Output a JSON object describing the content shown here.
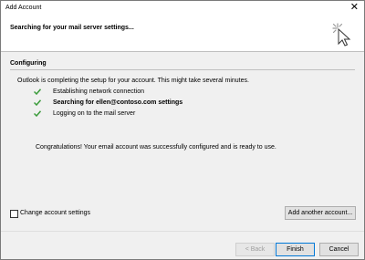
{
  "window": {
    "title": "Add Account"
  },
  "header": {
    "heading": "Searching for your mail server settings..."
  },
  "section": {
    "title": "Configuring"
  },
  "intro": "Outlook is completing the setup for your account. This might take several minutes.",
  "steps": [
    {
      "label": "Establishing network connection",
      "status": "done",
      "current": false
    },
    {
      "label": "Searching for ellen@contoso.com settings",
      "status": "done",
      "current": true
    },
    {
      "label": "Logging on to the mail server",
      "status": "done",
      "current": false
    }
  ],
  "congrats": "Congratulations! Your email account was successfully configured and is ready to use.",
  "options": {
    "change_settings_label": "Change account settings",
    "change_settings_checked": false
  },
  "buttons": {
    "add_another": "Add another account...",
    "back": "< Back",
    "finish": "Finish",
    "cancel": "Cancel"
  },
  "colors": {
    "check": "#3c9c3c",
    "accent": "#0078d7"
  }
}
